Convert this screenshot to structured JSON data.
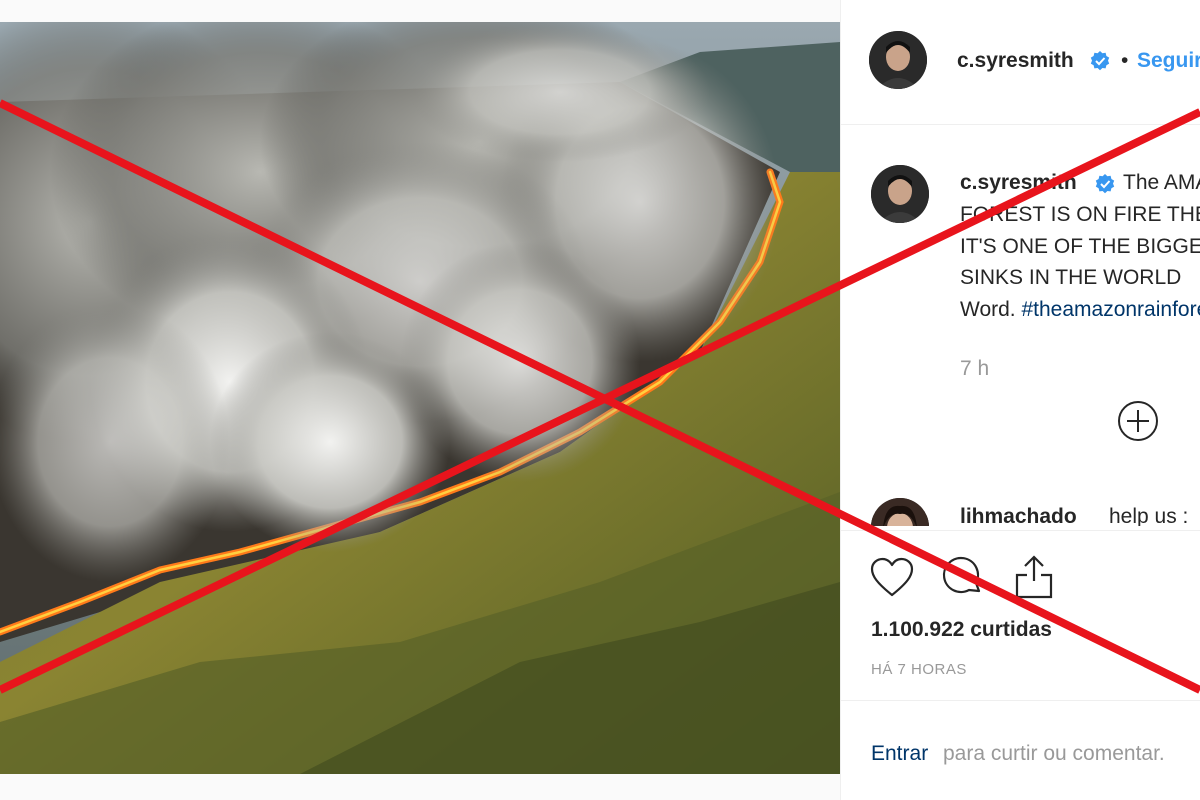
{
  "post": {
    "image_alt": "",
    "header": {
      "username": "c.syresmith",
      "separator": "•",
      "follow_label": "Seguir"
    },
    "caption": {
      "username": "c.syresmith",
      "line1": "The AMAZON",
      "line2": "FOREST IS ON FIRE THE",
      "line3": "IT'S ONE OF THE BIGGEST",
      "line4": "SINKS IN THE WORLD",
      "line5_text": "Word. ",
      "line5_hashtag": "#theamazonrainforest"
    },
    "time_ago": "7 h",
    "comment": {
      "username": "lihmachado",
      "text": "help us :"
    },
    "likes": "1.100.922 curtidas",
    "posted": "HÁ 7 HORAS",
    "login": {
      "link": "Entrar",
      "rest": "para curtir ou comentar."
    }
  },
  "icons": {
    "verified": "verified-badge-icon",
    "load_more": "plus-circle-icon",
    "like": "heart-icon",
    "comment": "comment-bubble-icon",
    "share": "share-icon"
  },
  "colors": {
    "link_blue": "#3897f0",
    "hashtag": "#003569",
    "overlay_red": "#e8141c",
    "muted": "#999999"
  }
}
